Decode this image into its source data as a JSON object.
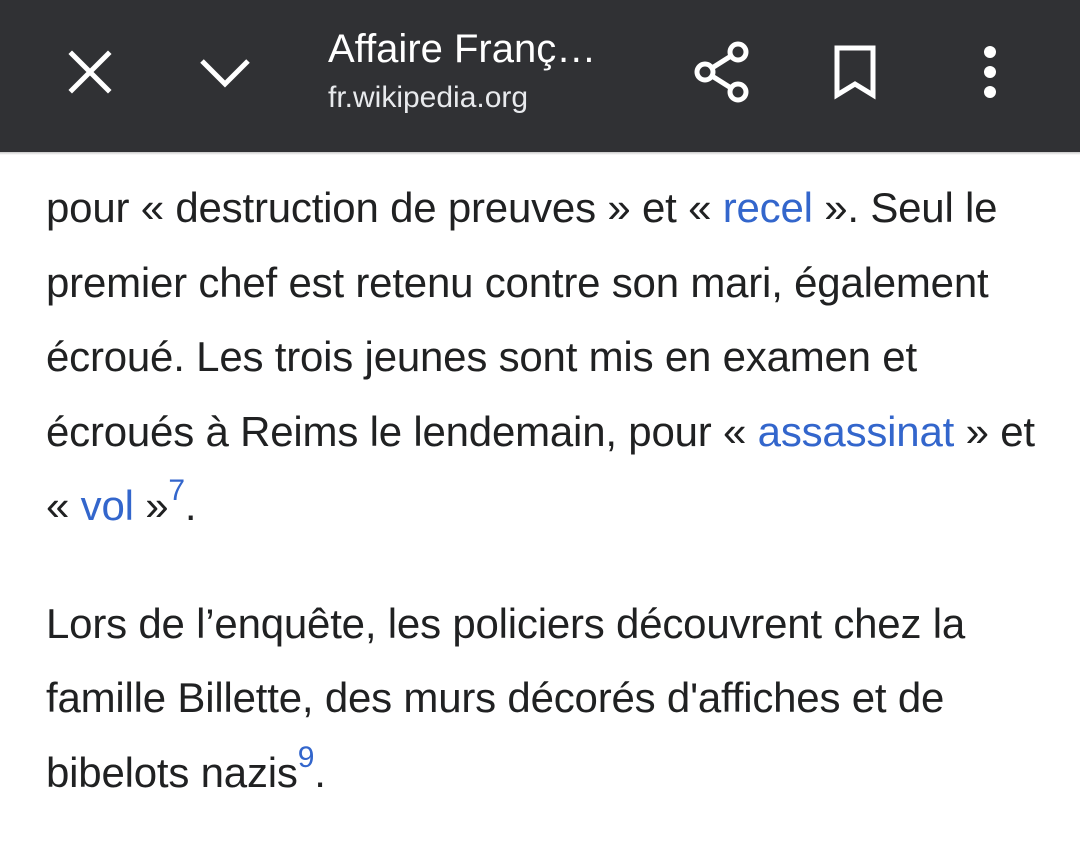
{
  "toolbar": {
    "title": "Affaire Franç…",
    "url": "fr.wikipedia.org",
    "close_icon": "close-icon",
    "collapse_icon": "chevron-down-icon",
    "share_icon": "share-icon",
    "bookmark_icon": "bookmark-icon",
    "menu_icon": "more-vert-icon",
    "background_color": "#303134"
  },
  "article": {
    "paragraph1": {
      "t1": "pour « destruction de preuves » et « ",
      "link_recel": "recel",
      "t2": " ». Seul le premier chef est retenu contre son mari, également écroué. Les trois jeunes sont mis en examen et écroués à Reims le lendemain, pour « ",
      "link_assassinat": "assassinat",
      "t3": " » et « ",
      "link_vol": "vol",
      "t4": " »",
      "ref": "7",
      "t5": "."
    },
    "paragraph2": {
      "t1": "Lors de l’enquête, les policiers découvrent chez la famille Billette, des murs décorés d'affiches et de bibelots nazis",
      "ref": "9",
      "t2": "."
    },
    "link_color": "#3366cc",
    "text_color": "#202122"
  }
}
